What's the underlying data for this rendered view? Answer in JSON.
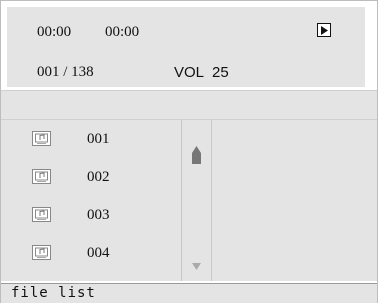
{
  "status": {
    "elapsed_time": "00:00",
    "total_time": "00:00",
    "play_state_icon": "play-icon",
    "track_position": "001 / 138",
    "volume_label": "VOL",
    "volume_value": "25"
  },
  "file_list": {
    "item_icon": "music-file-icon",
    "items": [
      {
        "label": "001"
      },
      {
        "label": "002"
      },
      {
        "label": "003"
      },
      {
        "label": "004"
      }
    ],
    "scrollbar": {
      "up_icon": "scroll-up-arrow-icon",
      "down_icon": "scroll-down-arrow-icon"
    }
  },
  "footer": {
    "label": "file list"
  },
  "colors": {
    "panel": "#e4e4e4",
    "text": "#111111",
    "thumb": "#777777"
  }
}
